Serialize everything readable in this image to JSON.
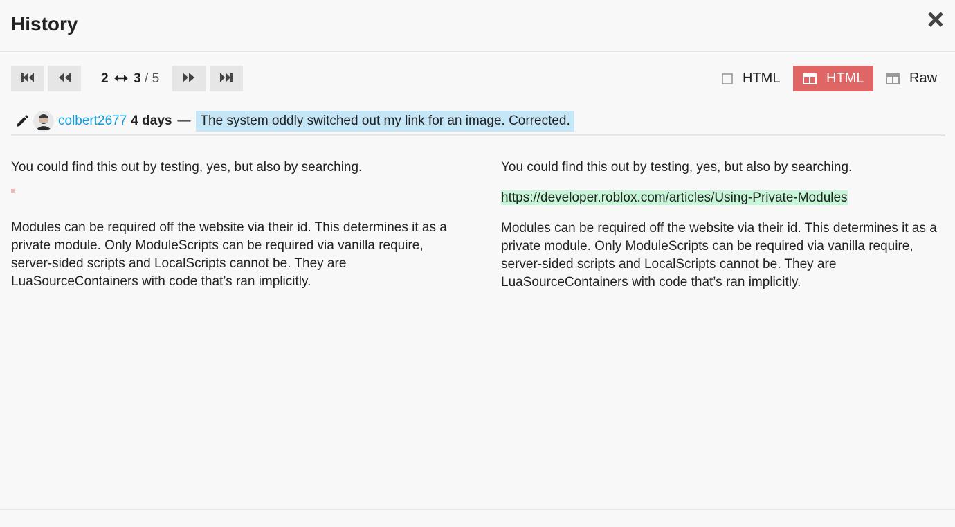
{
  "modal": {
    "title": "History",
    "close_icon": "close-icon"
  },
  "navigation": {
    "first_icon": "skip-to-first-icon",
    "prev_icon": "rewind-icon",
    "next_icon": "fast-forward-icon",
    "last_icon": "skip-to-last-icon",
    "from_revision": "2",
    "to_revision": "3",
    "separator": "/",
    "total_revisions": "5",
    "arrow_icon": "left-right-arrow-icon"
  },
  "view_modes": {
    "inline_html_label": "HTML",
    "side_by_side_html_label": "HTML",
    "side_by_side_raw_label": "Raw",
    "active_color": "#e06666"
  },
  "revision": {
    "username": "colbert2677",
    "age": "4 days",
    "dash": "—",
    "edit_reason": "The system oddly switched out my link for an image. Corrected.",
    "username_color": "#0f9ce0",
    "edit_reason_bg": "#c5e6f7"
  },
  "diff": {
    "left": {
      "paragraph_1": "You could find this out by testing, yes, but also by searching.",
      "paragraph_2": "Modules can be required off the website via their id. This determines it as a private module. Only ModuleScripts can be required via vanilla require, server-sided scripts and LocalScripts cannot be. They are LuaSourceContainers with code that’s ran implicitly."
    },
    "right": {
      "paragraph_1": "You could find this out by testing, yes, but also by searching.",
      "inserted_link": "https://developer.roblox.com/articles/Using-Private-Modules",
      "paragraph_2": "Modules can be required off the website via their id. This determines it as a private module. Only ModuleScripts can be required via vanilla require, server-sided scripts and LocalScripts cannot be. They are LuaSourceContainers with code that’s ran implicitly."
    },
    "removed_color": "#f2b8b8",
    "inserted_color": "#c6f5d8"
  }
}
